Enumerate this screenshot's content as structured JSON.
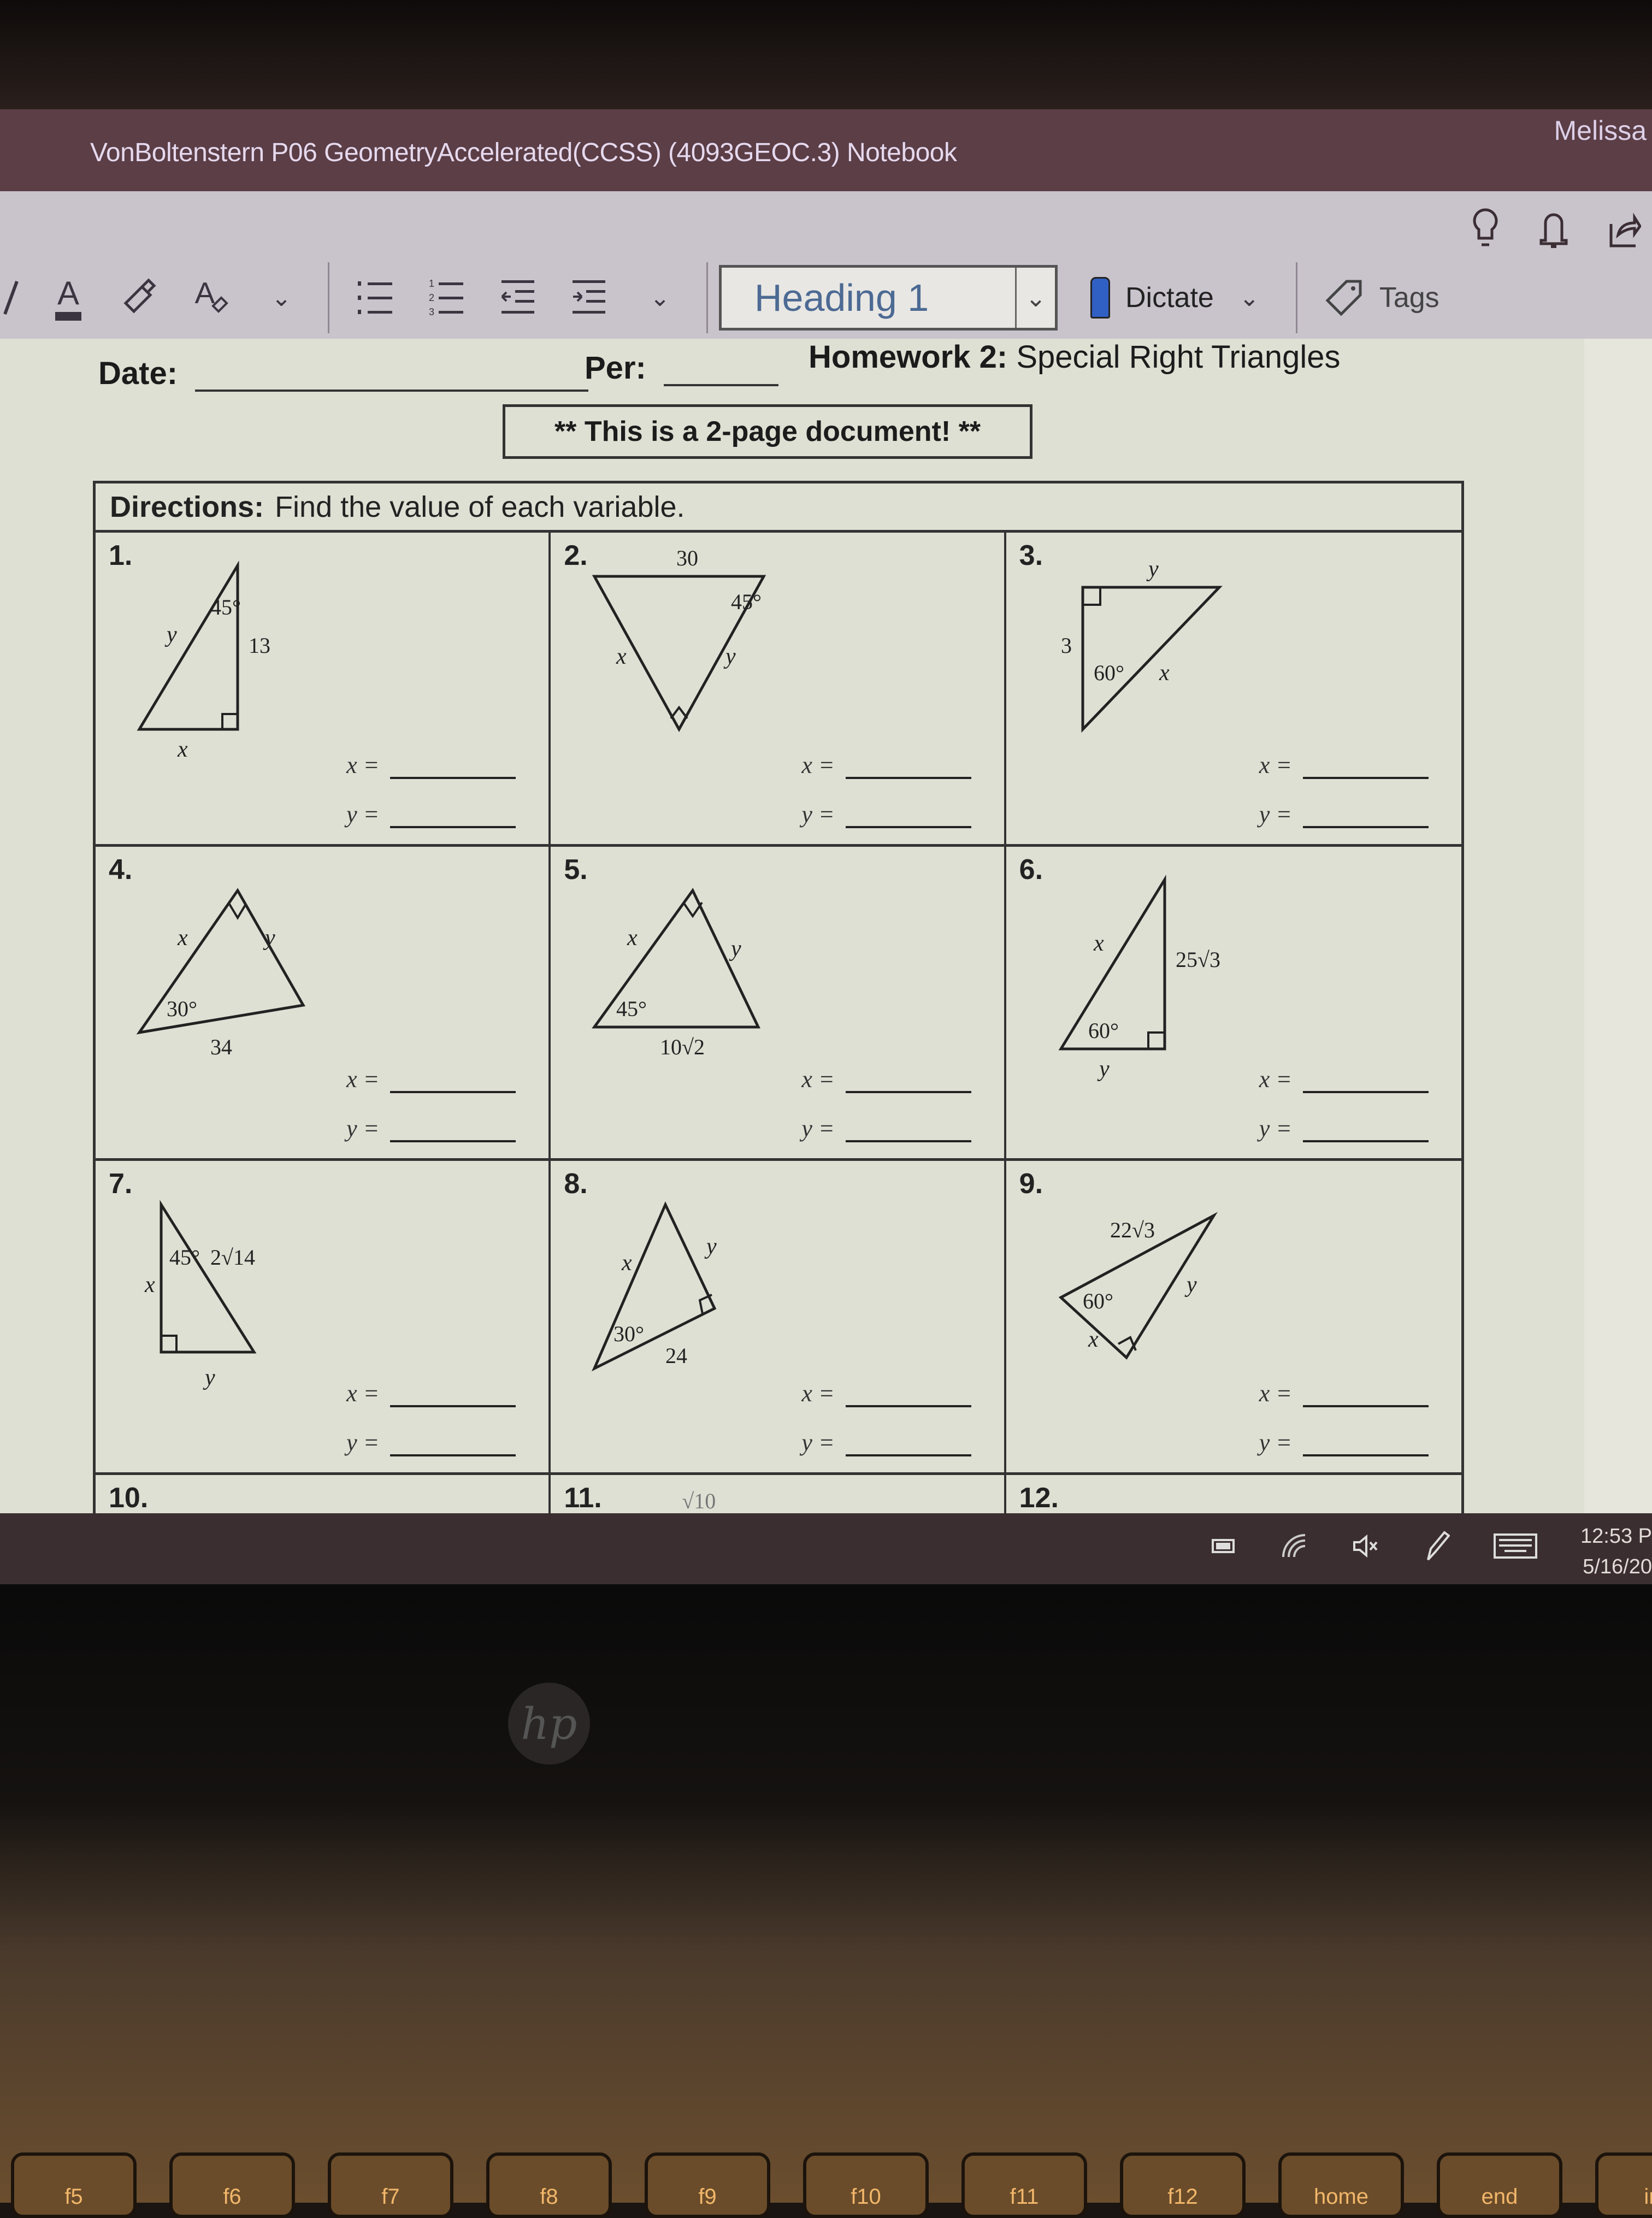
{
  "window": {
    "title": "VonBoltenstern P06 GeometryAccelerated(CCSS) (4093GEOC.3) Notebook",
    "user": "Melissa"
  },
  "ribbon": {
    "top_icons": [
      "lightbulb-icon",
      "bell-icon",
      "share-icon"
    ],
    "style_dropdown": {
      "value": "Heading 1"
    },
    "dictate_label": "Dictate",
    "tags_label": "Tags"
  },
  "worksheet": {
    "date_label": "Date:",
    "per_label": "Per:",
    "title_bold": "Homework 2:",
    "title_rest": " Special Right Triangles",
    "notice": "** This is a 2-page document! **",
    "directions_bold": "Directions:",
    "directions_text": "Find the value of each variable.",
    "answer_x_label": "x =",
    "answer_y_label": "y =",
    "problems": [
      {
        "num": "1.",
        "labels": {
          "angle": "45°",
          "side": "13",
          "v1": "y",
          "v2": "x"
        }
      },
      {
        "num": "2.",
        "labels": {
          "angle": "45°",
          "side": "30",
          "v1": "x",
          "v2": "y"
        }
      },
      {
        "num": "3.",
        "labels": {
          "angle": "60°",
          "side": "3",
          "v1": "y",
          "v2": "x"
        }
      },
      {
        "num": "4.",
        "labels": {
          "angle": "30°",
          "side": "34",
          "v1": "x",
          "v2": "y"
        }
      },
      {
        "num": "5.",
        "labels": {
          "angle": "45°",
          "side": "10√2",
          "v1": "x",
          "v2": "y"
        }
      },
      {
        "num": "6.",
        "labels": {
          "angle": "60°",
          "side": "25√3",
          "v1": "x",
          "v2": "y"
        }
      },
      {
        "num": "7.",
        "labels": {
          "angle": "45°",
          "side": "2√14",
          "v1": "x",
          "v2": "y"
        }
      },
      {
        "num": "8.",
        "labels": {
          "angle": "30°",
          "side": "24",
          "v1": "x",
          "v2": "y"
        }
      },
      {
        "num": "9.",
        "labels": {
          "angle": "60°",
          "side": "22√3",
          "v1": "x",
          "v2": "y"
        }
      },
      {
        "num": "10."
      },
      {
        "num": "11.",
        "partial_label": "√10"
      },
      {
        "num": "12."
      }
    ]
  },
  "taskbar": {
    "tray_icons": [
      "battery-icon",
      "wifi-icon",
      "volume-muted-icon",
      "pen-icon",
      "keyboard-icon"
    ],
    "time": "12:53 P",
    "date": "5/16/20"
  },
  "keyboard": {
    "keys": [
      "f5",
      "f6",
      "f7",
      "f8",
      "f9",
      "f10",
      "f11",
      "f12",
      "home",
      "end",
      "ins"
    ]
  }
}
